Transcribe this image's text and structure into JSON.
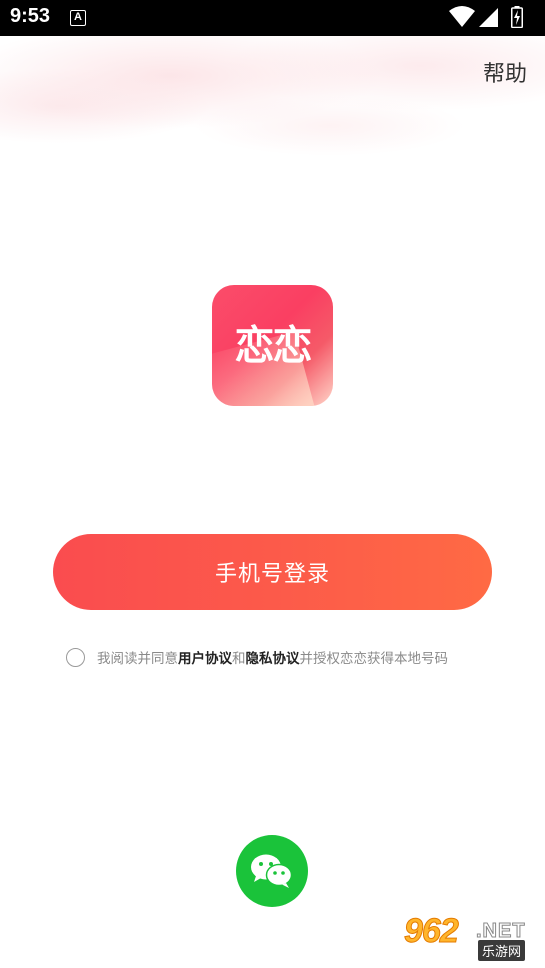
{
  "status_bar": {
    "time": "9:53",
    "notification_letter": "A",
    "icons": [
      "wifi-icon",
      "signal-icon",
      "battery-icon"
    ]
  },
  "header": {
    "help_label": "帮助"
  },
  "logo": {
    "text": "恋恋",
    "colors": [
      "#fb4d6a",
      "#ffd6c9"
    ]
  },
  "login": {
    "phone_button_label": "手机号登录",
    "button_color_start": "#fa4c4f",
    "button_color_end": "#ff6a44"
  },
  "agreement": {
    "prefix": "我阅读并同意",
    "user_agreement": "用户协议",
    "conjunction": "和",
    "privacy_agreement": "隐私协议",
    "suffix": "并授权恋恋获得本地号码",
    "checked": false
  },
  "third_party": {
    "wechat_icon": "wechat-icon",
    "wechat_color": "#1ac33a"
  },
  "watermark": {
    "number": "962",
    "net": ".NET",
    "site": "乐游网"
  }
}
